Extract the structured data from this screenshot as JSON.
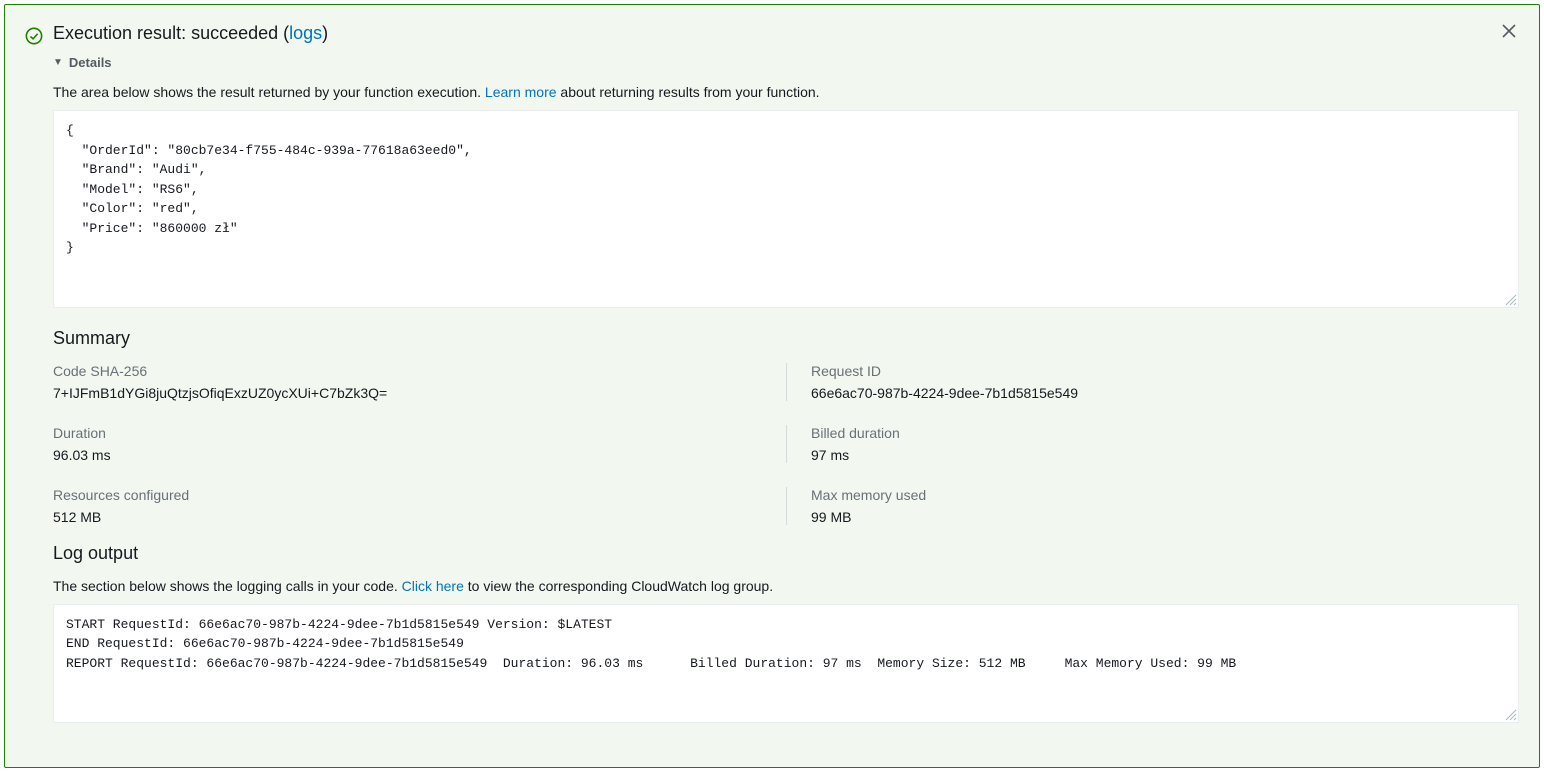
{
  "header": {
    "title_prefix": "Execution result: succeeded (",
    "logs_link": "logs",
    "title_suffix": ")"
  },
  "details": {
    "toggle_label": "Details",
    "description_before": "The area below shows the result returned by your function execution. ",
    "learn_more": "Learn more",
    "description_after": " about returning results from your function.",
    "result_json": "{\n  \"OrderId\": \"80cb7e34-f755-484c-939a-77618a63eed0\",\n  \"Brand\": \"Audi\",\n  \"Model\": \"RS6\",\n  \"Color\": \"red\",\n  \"Price\": \"860000 zł\"\n}"
  },
  "summary": {
    "title": "Summary",
    "items": {
      "code_sha_label": "Code SHA-256",
      "code_sha_value": "7+IJFmB1dYGi8juQtzjsOfiqExzUZ0ycXUi+C7bZk3Q=",
      "request_id_label": "Request ID",
      "request_id_value": "66e6ac70-987b-4224-9dee-7b1d5815e549",
      "duration_label": "Duration",
      "duration_value": "96.03 ms",
      "billed_duration_label": "Billed duration",
      "billed_duration_value": "97 ms",
      "resources_label": "Resources configured",
      "resources_value": "512 MB",
      "max_mem_label": "Max memory used",
      "max_mem_value": "99 MB"
    }
  },
  "log_output": {
    "title": "Log output",
    "description_before": "The section below shows the logging calls in your code. ",
    "click_here": "Click here",
    "description_after": " to view the corresponding CloudWatch log group.",
    "log_text": "START RequestId: 66e6ac70-987b-4224-9dee-7b1d5815e549 Version: $LATEST\nEND RequestId: 66e6ac70-987b-4224-9dee-7b1d5815e549\nREPORT RequestId: 66e6ac70-987b-4224-9dee-7b1d5815e549  Duration: 96.03 ms      Billed Duration: 97 ms  Memory Size: 512 MB     Max Memory Used: 99 MB"
  }
}
